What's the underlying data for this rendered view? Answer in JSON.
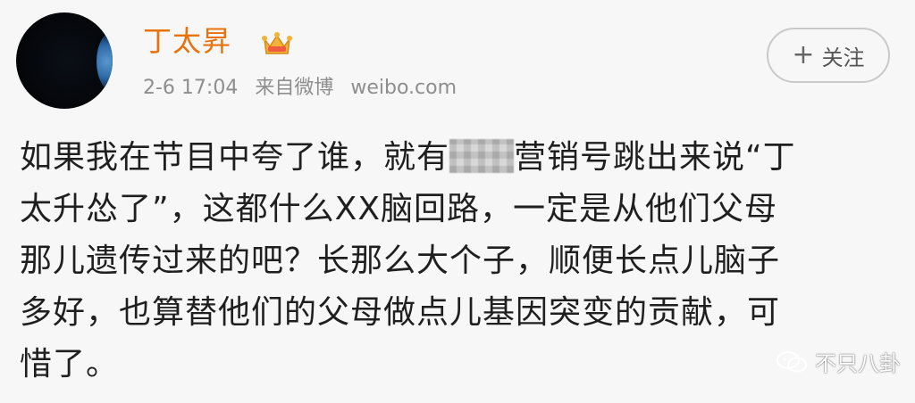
{
  "post": {
    "username": "丁太昇",
    "time": "2-6 17:04",
    "source": "来自微博",
    "domain": "weibo.com",
    "follow_label": "关注",
    "follow_plus": "+",
    "lines": [
      {
        "before": "如果我在节目中夸了谁，就有",
        "masked": "",
        "after": "营销号跳出来说“丁"
      },
      {
        "text": "太升怂了”，这都什么XX脑回路，一定是从他们父母"
      },
      {
        "text": "那儿遗传过来的吧？长那么大个子，顺便长点儿脑子"
      },
      {
        "text": "多好，也算替他们的父母做点儿基因突变的贡献，可"
      },
      {
        "text": "惜了。"
      }
    ]
  },
  "watermark": {
    "text": "不只八卦",
    "icon": "wechat-icon"
  },
  "colors": {
    "username": "#e8720c",
    "meta": "#8e8e8e",
    "body": "#1f1f1f",
    "background": "#f7f7f7"
  }
}
